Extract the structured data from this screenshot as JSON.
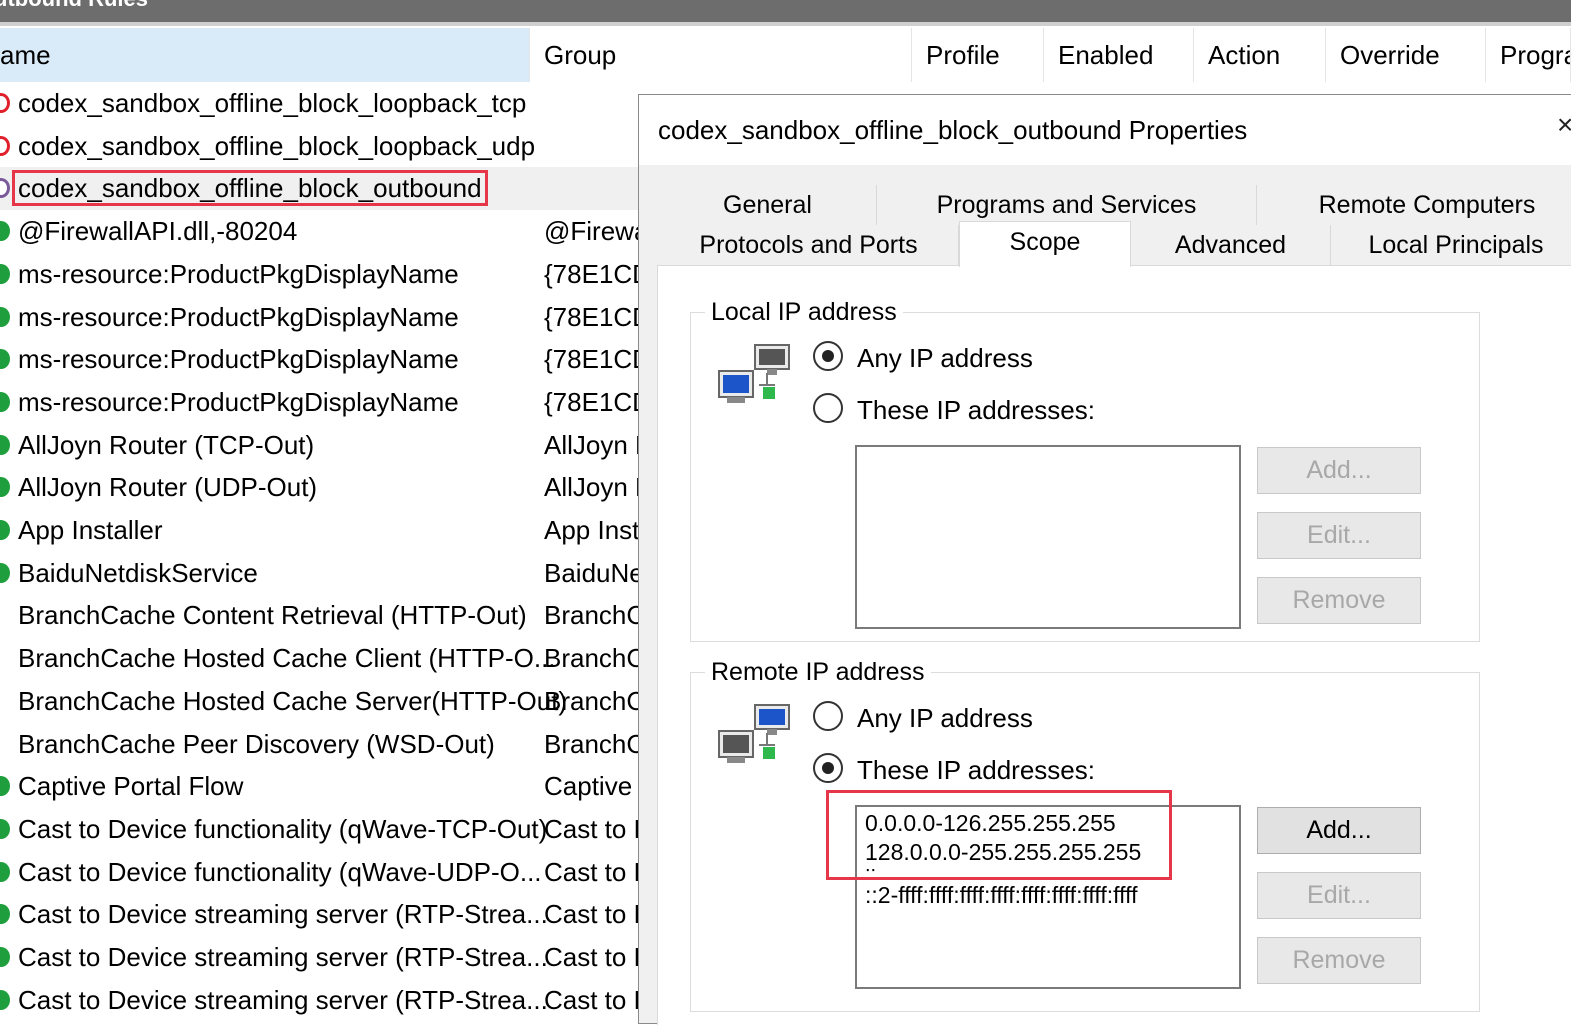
{
  "window": {
    "title": "utbound Rules"
  },
  "columns": [
    {
      "id": "name",
      "label": "ame"
    },
    {
      "id": "group",
      "label": "Group"
    },
    {
      "id": "profile",
      "label": "Profile"
    },
    {
      "id": "enabled",
      "label": "Enabled"
    },
    {
      "id": "action",
      "label": "Action"
    },
    {
      "id": "override",
      "label": "Override"
    },
    {
      "id": "program",
      "label": "Progra"
    }
  ],
  "rows": [
    {
      "name": "codex_sandbox_offline_block_loopback_tcp",
      "group": "",
      "icon": "block-rule-icon"
    },
    {
      "name": "codex_sandbox_offline_block_loopback_udp",
      "group": "",
      "icon": "block-rule-icon"
    },
    {
      "name": "codex_sandbox_offline_block_outbound",
      "group": "",
      "icon": "block-rule-icon",
      "selected": true
    },
    {
      "name": "@FirewallAPI.dll,-80204",
      "group": "@Firewa",
      "icon": "allow-rule-icon"
    },
    {
      "name": "ms-resource:ProductPkgDisplayName",
      "group": "{78E1CD",
      "icon": "allow-rule-icon"
    },
    {
      "name": "ms-resource:ProductPkgDisplayName",
      "group": "{78E1CD",
      "icon": "allow-rule-icon"
    },
    {
      "name": "ms-resource:ProductPkgDisplayName",
      "group": "{78E1CD",
      "icon": "allow-rule-icon"
    },
    {
      "name": "ms-resource:ProductPkgDisplayName",
      "group": "{78E1CD",
      "icon": "allow-rule-icon"
    },
    {
      "name": "AllJoyn Router (TCP-Out)",
      "group": "AllJoyn R",
      "icon": "allow-rule-icon"
    },
    {
      "name": "AllJoyn Router (UDP-Out)",
      "group": "AllJoyn R",
      "icon": "allow-rule-icon"
    },
    {
      "name": "App Installer",
      "group": "App Inst",
      "icon": "allow-rule-icon"
    },
    {
      "name": "BaiduNetdiskService",
      "group": "BaiduNe",
      "icon": "allow-rule-icon"
    },
    {
      "name": "BranchCache Content Retrieval (HTTP-Out)",
      "group": "BranchCa",
      "icon": "none"
    },
    {
      "name": "BranchCache Hosted Cache Client (HTTP-O...",
      "group": "BranchCa",
      "icon": "none"
    },
    {
      "name": "BranchCache Hosted Cache Server(HTTP-Out)",
      "group": "BranchCa",
      "icon": "none"
    },
    {
      "name": "BranchCache Peer Discovery (WSD-Out)",
      "group": "BranchCa",
      "icon": "none"
    },
    {
      "name": "Captive Portal Flow",
      "group": "Captive I",
      "icon": "allow-rule-icon"
    },
    {
      "name": "Cast to Device functionality (qWave-TCP-Out)",
      "group": "Cast to D",
      "icon": "allow-rule-icon"
    },
    {
      "name": "Cast to Device functionality (qWave-UDP-O...",
      "group": "Cast to D",
      "icon": "allow-rule-icon"
    },
    {
      "name": "Cast to Device streaming server (RTP-Strea...",
      "group": "Cast to D",
      "icon": "allow-rule-icon"
    },
    {
      "name": "Cast to Device streaming server (RTP-Strea...",
      "group": "Cast to D",
      "icon": "allow-rule-icon"
    },
    {
      "name": "Cast to Device streaming server (RTP-Strea...",
      "group": "Cast to D",
      "icon": "allow-rule-icon"
    }
  ],
  "dialog": {
    "title": "codex_sandbox_offline_block_outbound Properties",
    "close": "×",
    "tabs_row1": [
      "General",
      "Programs and Services",
      "Remote Computers"
    ],
    "tabs_row2": [
      "Protocols and Ports",
      "Scope",
      "Advanced",
      "Local Principals"
    ],
    "active_tab": "Scope",
    "local": {
      "label": "Local IP address",
      "any_label": "Any IP address",
      "these_label": "These IP addresses:",
      "selected": "any",
      "addresses": [],
      "add": "Add...",
      "edit": "Edit...",
      "remove": "Remove"
    },
    "remote": {
      "label": "Remote IP address",
      "any_label": "Any IP address",
      "these_label": "These IP addresses:",
      "selected": "these",
      "addresses": [
        "0.0.0.0-126.255.255.255",
        "128.0.0.0-255.255.255.255",
        "::",
        "::2-ffff:ffff:ffff:ffff:ffff:ffff:ffff:ffff"
      ],
      "add": "Add...",
      "edit": "Edit...",
      "remove": "Remove"
    }
  }
}
